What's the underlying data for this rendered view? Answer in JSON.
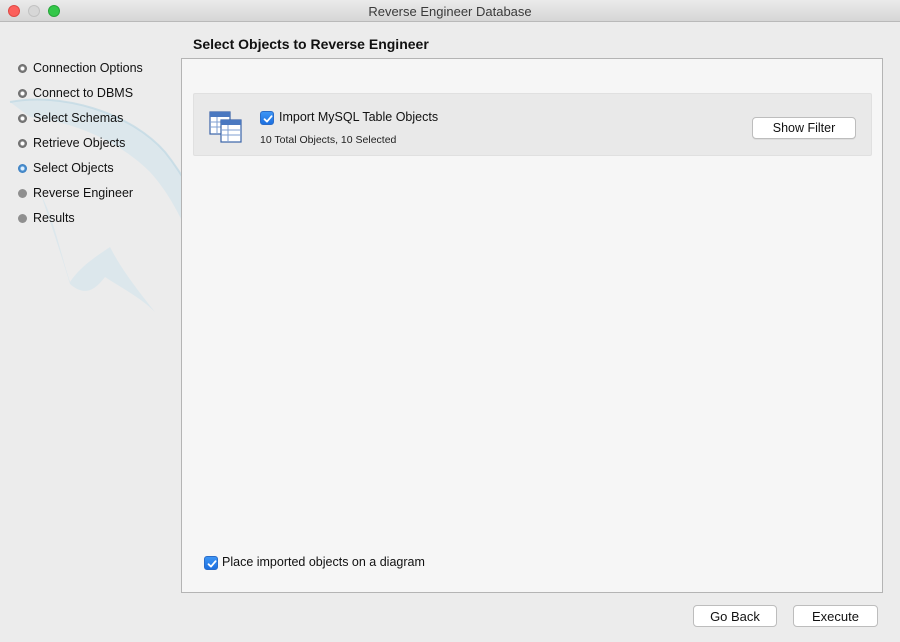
{
  "window": {
    "title": "Reverse Engineer Database"
  },
  "sidebar": {
    "steps": [
      {
        "label": "Connection Options",
        "state": "done"
      },
      {
        "label": "Connect to DBMS",
        "state": "done"
      },
      {
        "label": "Select Schemas",
        "state": "done"
      },
      {
        "label": "Retrieve Objects",
        "state": "done"
      },
      {
        "label": "Select Objects",
        "state": "current"
      },
      {
        "label": "Reverse Engineer",
        "state": "pending"
      },
      {
        "label": "Results",
        "state": "pending"
      }
    ]
  },
  "main": {
    "heading": "Select Objects to Reverse Engineer",
    "objects": {
      "import_label": "Import MySQL Table Objects",
      "import_checked": true,
      "count_text": "10 Total Objects, 10 Selected",
      "filter_button": "Show Filter",
      "icon": "table-objects-icon"
    },
    "place_on_diagram": {
      "label": "Place imported objects on a diagram",
      "checked": true
    }
  },
  "footer": {
    "back_button": "Go Back",
    "execute_button": "Execute"
  },
  "colors": {
    "accent": "#1c6fe0",
    "current_step": "#4a8fd0",
    "close": "#fc605c",
    "maximize": "#34c84a"
  }
}
